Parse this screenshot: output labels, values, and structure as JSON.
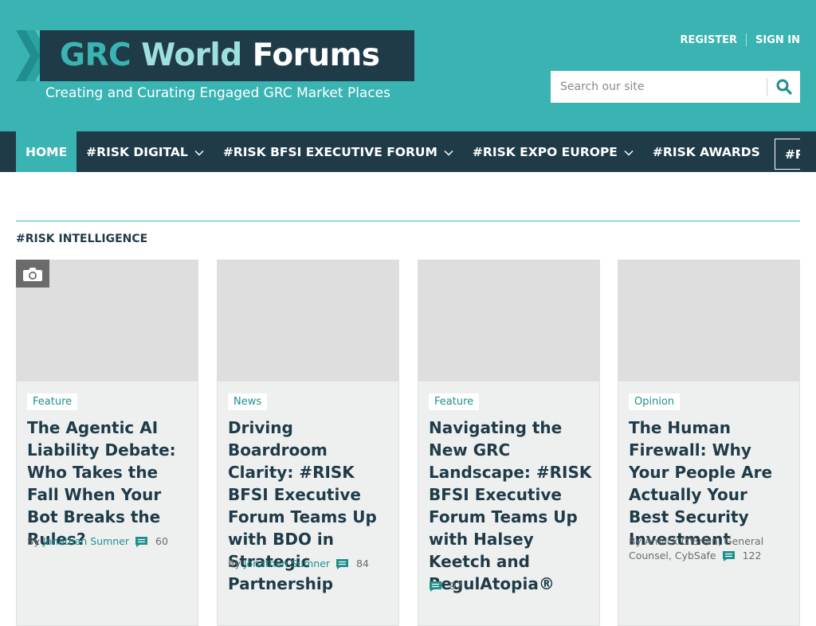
{
  "logo": {
    "word1": "GRC",
    "word2": "World",
    "word3": "Forums",
    "tagline": "Creating and Curating Engaged GRC Market Places"
  },
  "account": {
    "register": "REGISTER",
    "sign_in": "SIGN IN"
  },
  "search": {
    "placeholder": "Search our site",
    "icon": "search-icon"
  },
  "nav": {
    "items": [
      {
        "label": "HOME",
        "active": true,
        "dropdown": false
      },
      {
        "label": "#RISK DIGITAL",
        "dropdown": true
      },
      {
        "label": "#RISK BFSI EXECUTIVE FORUM",
        "dropdown": true
      },
      {
        "label": "#RISK EXPO EUROPE",
        "dropdown": true
      },
      {
        "label": "#RISK AWARDS",
        "dropdown": false
      },
      {
        "label": "#RISK EXPO T",
        "boxed": true
      }
    ]
  },
  "section": {
    "title": "#RISK INTELLIGENCE"
  },
  "articles": [
    {
      "tag": "Feature",
      "title": "The Agentic AI Liability Debate: Who Takes the Fall When Your Bot Breaks the Rules?",
      "by": "By",
      "author": "Jonathan Sumner",
      "comments": "60",
      "has_camera": true
    },
    {
      "tag": "News",
      "title": "Driving Boardroom Clarity: #RISK BFSI Executive Forum Teams Up with BDO in Strategic Partnership",
      "by": "By",
      "author": "Jonathan Sumner",
      "comments": "84"
    },
    {
      "tag": "Feature",
      "title": "Navigating the New GRC Landscape: #RISK BFSI Executive Forum Teams Up with Halsey Keetch and RegulAtopia®",
      "comments": "97"
    },
    {
      "tag": "Opinion",
      "title": "The Human Firewall: Why Your People Are Actually Your Best Security Investment",
      "byline_text": "By Annick O'Brien, General Counsel, CybSafe",
      "comments": "122"
    }
  ],
  "colors": {
    "header_bg": "#3ab4b2",
    "nav_bg": "#1f3b48",
    "accent": "#1f8f8d",
    "card_bg": "#eef0f0",
    "image_placeholder": "#dedede"
  }
}
